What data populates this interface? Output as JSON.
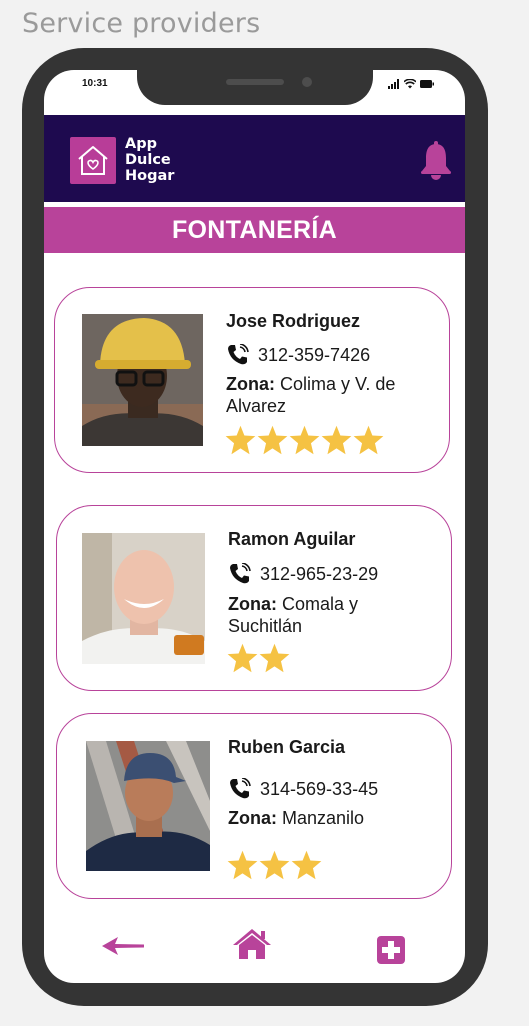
{
  "page": {
    "title": "Service providers"
  },
  "status_bar": {
    "time": "10:31"
  },
  "header": {
    "logo_lines": [
      "App",
      "Dulce",
      "Hogar"
    ],
    "logo_icon": "house-heart-icon",
    "notification_icon": "bell-icon"
  },
  "section": {
    "title": "FONTANERÍA"
  },
  "providers": [
    {
      "name": "Jose Rodriguez",
      "phone": "312-359-7426",
      "zone_label": "Zona:",
      "zone": "Colima y V. de Alvarez",
      "rating": 5
    },
    {
      "name": "Ramon Aguilar",
      "phone": "312-965-23-29",
      "zone_label": "Zona:",
      "zone": "Comala y Suchitlán",
      "rating": 2
    },
    {
      "name": "Ruben Garcia",
      "phone": "314-569-33-45",
      "zone_label": "Zona:",
      "zone": "Manzanilo",
      "rating": 3
    }
  ],
  "nav": {
    "back_icon": "arrow-left-icon",
    "home_icon": "home-icon",
    "add_icon": "plus-square-icon"
  },
  "colors": {
    "accent": "#b8439a",
    "header_bg": "#1e0a4f",
    "star": "#f5c243",
    "phone_body": "#343434"
  }
}
